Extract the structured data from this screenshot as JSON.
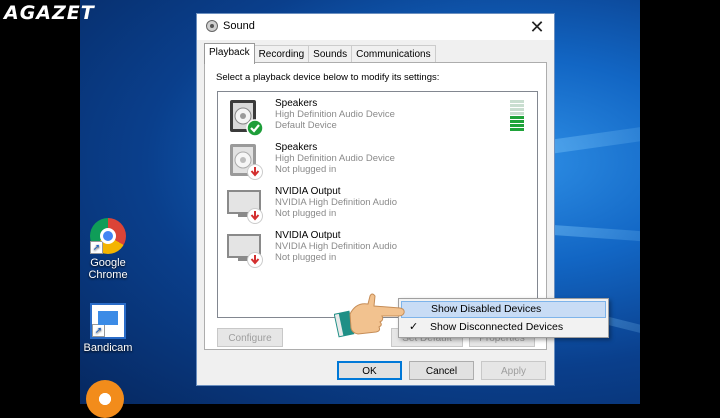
{
  "watermark": "AGAZET",
  "desktop_icons": [
    {
      "label_line1": "Google",
      "label_line2": "Chrome",
      "icon": "chrome-icon"
    },
    {
      "label_line1": "Bandicam",
      "label_line2": "",
      "icon": "bandicam-icon"
    }
  ],
  "dialog": {
    "title": "Sound",
    "close_glyph": "✕",
    "tabs": [
      {
        "label": "Playback",
        "active": true
      },
      {
        "label": "Recording",
        "active": false
      },
      {
        "label": "Sounds",
        "active": false
      },
      {
        "label": "Communications",
        "active": false
      }
    ],
    "instruction": "Select a playback device below to modify its settings:",
    "devices": [
      {
        "name": "Speakers",
        "description": "High Definition Audio Device",
        "status": "Default Device",
        "icon": "speaker-icon",
        "badge": "check-badge-icon"
      },
      {
        "name": "Speakers",
        "description": "High Definition Audio Device",
        "status": "Not plugged in",
        "icon": "speaker-icon",
        "badge": "unplugged-badge-icon"
      },
      {
        "name": "NVIDIA Output",
        "description": "NVIDIA High Definition Audio",
        "status": "Not plugged in",
        "icon": "monitor-icon",
        "badge": "unplugged-badge-icon"
      },
      {
        "name": "NVIDIA Output",
        "description": "NVIDIA High Definition Audio",
        "status": "Not plugged in",
        "icon": "monitor-icon",
        "badge": "unplugged-badge-icon"
      }
    ],
    "level_meter": {
      "segments": 8,
      "active_fraction": 0.5
    },
    "configure_label": "Configure",
    "set_default_label": "Set Default",
    "properties_label": "Properties",
    "ok_label": "OK",
    "cancel_label": "Cancel",
    "apply_label": "Apply"
  },
  "context_menu": {
    "items": [
      {
        "label": "Show Disabled Devices",
        "checked": false,
        "highlighted": true
      },
      {
        "label": "Show Disconnected Devices",
        "checked": true,
        "highlighted": false
      }
    ],
    "check_glyph": "✓"
  },
  "colors": {
    "accent": "#0078d7",
    "check_green": "#1e9e3a",
    "unplugged_red": "#d32f2f",
    "meter_green": "#1fa33a"
  }
}
